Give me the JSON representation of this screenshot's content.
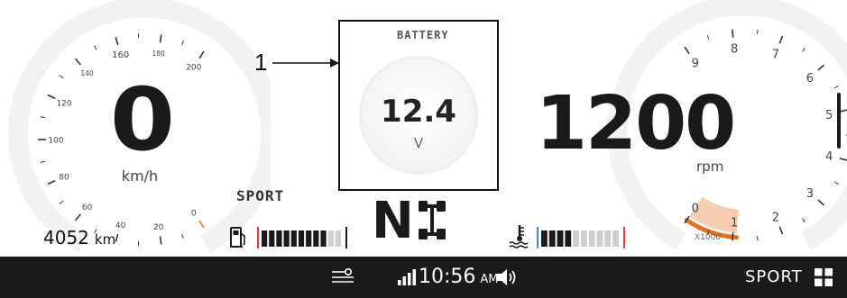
{
  "battery": {
    "title": "BATTERY",
    "value": "12.4",
    "unit": "V"
  },
  "callout": {
    "label": "1"
  },
  "speedometer": {
    "value": "0",
    "unit": "km/h",
    "tick_labels": [
      "0",
      "20",
      "40",
      "60",
      "80",
      "100",
      "120",
      "140",
      "160",
      "180",
      "200"
    ]
  },
  "odometer": {
    "value": "4052",
    "unit": "km"
  },
  "drive_mode_label": "SPORT",
  "tachometer": {
    "value": "1200",
    "unit": "rpm",
    "tick_labels": [
      "0",
      "1",
      "2",
      "3",
      "4",
      "5",
      "6",
      "7",
      "8",
      "9"
    ],
    "multiplier": "X1000",
    "level_fraction": 0.12
  },
  "gear": "N",
  "fuel": {
    "icon": "fuel-pump-icon",
    "filled_segments": 9,
    "total_segments": 11
  },
  "coolant": {
    "icon": "coolant-temperature-icon",
    "filled_segments": 4,
    "total_segments": 10
  },
  "status_bar": {
    "time": "10:56",
    "ampm": "AM",
    "drive_mode": "SPORT",
    "icons": [
      "road-icon",
      "signal-icon",
      "speaker-icon",
      "grid-icon"
    ]
  },
  "colors": {
    "accent": "#e8701e",
    "accent_light": "#f5cdb0",
    "fuel_marker": "#e0383e",
    "coolant_cold": "#3a8fd8",
    "coolant_hot": "#e0383e",
    "bar": "#1b1b1b",
    "text": "#1a1a1a"
  }
}
